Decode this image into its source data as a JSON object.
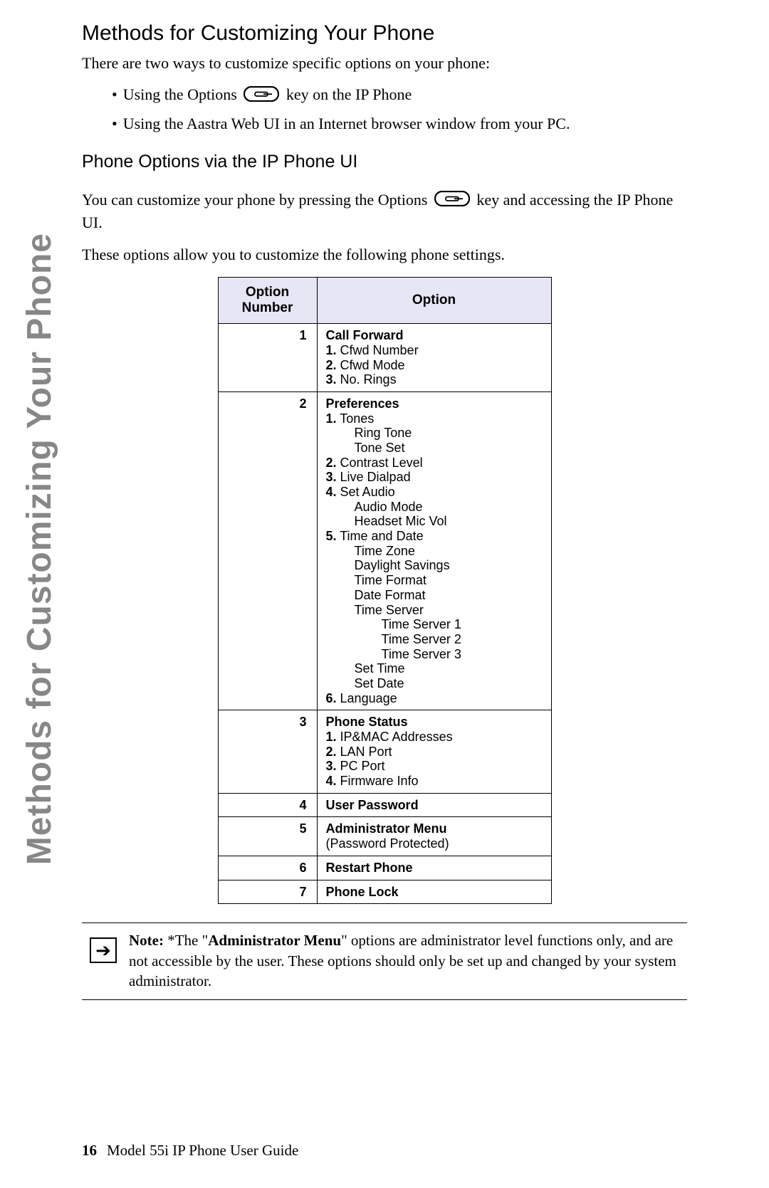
{
  "sideHeading": "Methods for Customizing Your Phone",
  "title": "Methods for Customizing Your Phone",
  "intro": "There are two ways to customize specific options on your phone:",
  "bullet1_a": "Using the Options",
  "bullet1_b": "key on the IP Phone",
  "bullet2": "Using the Aastra Web UI in an Internet browser window from your PC.",
  "subheading": "Phone Options via the IP Phone UI",
  "para2_a": "You can customize your phone by pressing the Options",
  "para2_b": "key and accessing the IP Phone UI.",
  "para3": "These options allow you to customize the following phone settings.",
  "table": {
    "header": {
      "col1": "Option Number",
      "col2": "Option"
    },
    "rows": {
      "r1": {
        "num": "1",
        "title": "Call Forward",
        "i1": "1.",
        "t1": "Cfwd Number",
        "i2": "2.",
        "t2": "Cfwd Mode",
        "i3": "3.",
        "t3": "No. Rings"
      },
      "r2": {
        "num": "2",
        "title": "Preferences",
        "i1": "1.",
        "t1": "Tones",
        "t1a": "Ring Tone",
        "t1b": "Tone Set",
        "i2": "2.",
        "t2": "Contrast Level",
        "i3": "3.",
        "t3": "Live Dialpad",
        "i4": "4.",
        "t4": "Set Audio",
        "t4a": "Audio Mode",
        "t4b": "Headset Mic Vol",
        "i5": "5.",
        "t5": "Time and Date",
        "t5a": "Time Zone",
        "t5b": "Daylight Savings",
        "t5c": "Time Format",
        "t5d": "Date Format",
        "t5e": "Time Server",
        "t5e1": "Time Server 1",
        "t5e2": "Time Server 2",
        "t5e3": "Time Server 3",
        "t5f": "Set Time",
        "t5g": "Set Date",
        "i6": "6.",
        "t6": "Language"
      },
      "r3": {
        "num": "3",
        "title": "Phone Status",
        "i1": "1.",
        "t1": "IP&MAC Addresses",
        "i2": "2.",
        "t2": "LAN Port",
        "i3": "3.",
        "t3": "PC Port",
        "i4": "4.",
        "t4": "Firmware Info"
      },
      "r4": {
        "num": "4",
        "title": "User Password"
      },
      "r5": {
        "num": "5",
        "title": "Administrator Menu",
        "sub": "(Password Protected)"
      },
      "r6": {
        "num": "6",
        "title": "Restart Phone"
      },
      "r7": {
        "num": "7",
        "title": "Phone Lock"
      }
    }
  },
  "note": {
    "label": "Note:",
    "pre": " *The \"",
    "admin": "Administrator Menu",
    "post": "\" options are administrator level functions only, and are not accessible by the user. These options should only be set up and changed by your system administrator."
  },
  "footer": {
    "page": "16",
    "title": "Model 55i IP Phone User Guide"
  }
}
